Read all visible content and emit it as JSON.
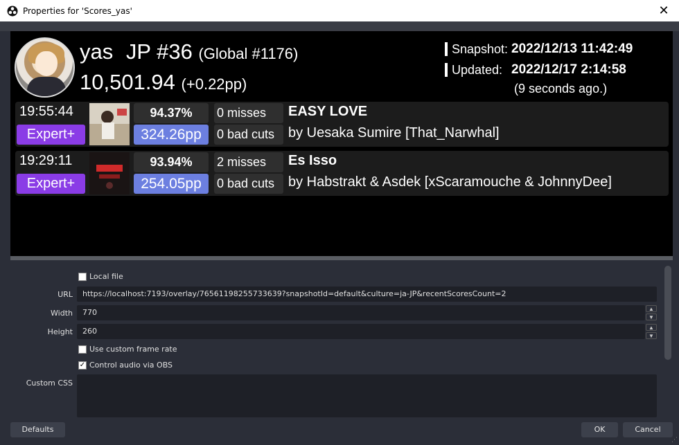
{
  "window": {
    "title": "Properties for 'Scores_yas'"
  },
  "profile": {
    "name": "yas",
    "country_rank": "JP #36",
    "global_rank": "(Global #1176)",
    "pp": "10,501.94",
    "pp_delta": "(+0.22pp)",
    "snapshot_label": "Snapshot:",
    "snapshot_value": "2022/12/13 11:42:49",
    "updated_label": "Updated:",
    "updated_value": "2022/12/17 2:14:58",
    "updated_ago": "(9 seconds ago.)"
  },
  "scores": [
    {
      "time": "19:55:44",
      "difficulty": "Expert+",
      "accuracy": "94.37%",
      "pp": "324.26pp",
      "misses": "0 misses",
      "bad_cuts": "0 bad cuts",
      "song": "EASY LOVE",
      "by": "by Uesaka Sumire  [That_Narwhal]"
    },
    {
      "time": "19:29:11",
      "difficulty": "Expert+",
      "accuracy": "93.94%",
      "pp": "254.05pp",
      "misses": "2 misses",
      "bad_cuts": "0 bad cuts",
      "song": "Es Isso",
      "by": "by Habstrakt & Asdek  [xScaramouche & JohnnyDee]"
    }
  ],
  "properties": {
    "local_file_label": "Local file",
    "url_label": "URL",
    "url_value": "https://localhost:7193/overlay/76561198255733639?snapshotId=default&culture=ja-JP&recentScoresCount=2",
    "width_label": "Width",
    "width_value": "770",
    "height_label": "Height",
    "height_value": "260",
    "custom_frame_rate_label": "Use custom frame rate",
    "control_audio_label": "Control audio via OBS",
    "custom_css_label": "Custom CSS"
  },
  "buttons": {
    "defaults": "Defaults",
    "ok": "OK",
    "cancel": "Cancel"
  },
  "colors": {
    "difficulty": "#8a3ce6",
    "pp_badge": "#6c7fe0",
    "window_bg": "#2b2e38"
  }
}
